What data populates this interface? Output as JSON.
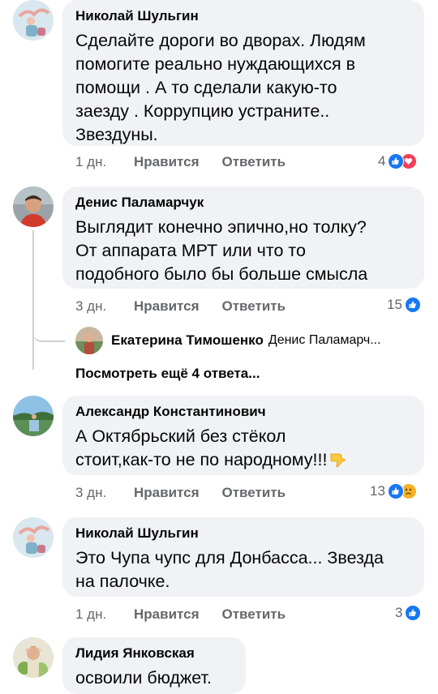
{
  "comments": [
    {
      "author": "Николай Шульгин",
      "text": "Сделайте дороги во дворах. Людям\nпомогите реально нуждающихся в\nпомощи . А то сделали какую-то\nзаезду . Коррупцию устраните..\nЗвездуны.",
      "time": "1 дн.",
      "like": "Нравится",
      "reply": "Ответить",
      "reactions_count": "4",
      "reactions": [
        "like-icon",
        "love-icon"
      ]
    },
    {
      "author": "Денис Паламарчук",
      "text": "Выглядит конечно эпично,но толку?\nОт аппарата МРТ или что то\nподобного было бы больше смысла",
      "time": "3 дн.",
      "like": "Нравится",
      "reply": "Ответить",
      "reactions_count": "15",
      "reactions": [
        "like-icon"
      ],
      "reply_preview": {
        "author": "Екатерина Тимошенко",
        "text": "Денис Паламарч..."
      },
      "more_replies": "Посмотреть ещё 4 ответа..."
    },
    {
      "author": "Александр Константинович",
      "text": "А Октябрьский без стёкол\nстоит,как-то не по народному!!!",
      "emoji": "thumbs-down-emoji",
      "time": "3 дн.",
      "like": "Нравится",
      "reply": "Ответить",
      "reactions_count": "13",
      "reactions": [
        "like-icon",
        "sad-icon"
      ]
    },
    {
      "author": "Николай Шульгин",
      "text": "Это Чупа чупс для Донбасса...  Звезда\nна палочке.",
      "time": "1 дн.",
      "like": "Нравится",
      "reply": "Ответить",
      "reactions_count": "3",
      "reactions": [
        "like-icon"
      ]
    },
    {
      "author": "Лидия Янковская",
      "text": "освоили бюджет."
    }
  ],
  "colors": {
    "like": "#1877f2",
    "love": "#f33e58",
    "sad": "#f7b125",
    "bubble": "#f0f2f5",
    "meta": "#65676b"
  }
}
